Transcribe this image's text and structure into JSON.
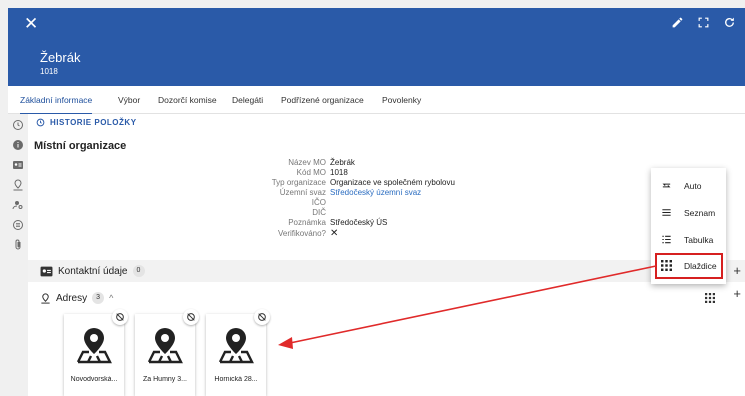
{
  "header": {
    "close_icon": "close-icon",
    "title": "Žebrák",
    "subtitle": "1018",
    "actions": [
      "edit-icon",
      "fullscreen-icon",
      "refresh-icon"
    ]
  },
  "tabs": [
    {
      "label": "Základní informace",
      "active": true
    },
    {
      "label": "Výbor"
    },
    {
      "label": "Dozorčí komise"
    },
    {
      "label": "Delegáti"
    },
    {
      "label": "Podřízené organizace"
    },
    {
      "label": "Povolenky"
    }
  ],
  "history": {
    "label": "HISTORIE POLOŽKY"
  },
  "section": {
    "title": "Místní organizace"
  },
  "details": [
    {
      "label": "Název MO",
      "value": "Žebrák"
    },
    {
      "label": "Kód MO",
      "value": "1018"
    },
    {
      "label": "Typ organizace",
      "value": "Organizace ve společném rybolovu"
    },
    {
      "label": "Územní svaz",
      "value": "Středočeský územní svaz",
      "link": true
    },
    {
      "label": "IČO",
      "value": ""
    },
    {
      "label": "DIČ",
      "value": ""
    },
    {
      "label": "Poznámka",
      "value": "Středočeský ÚS"
    },
    {
      "label": "Verifikováno?",
      "value": "✕"
    }
  ],
  "contacts": {
    "title": "Kontaktní údaje",
    "count": "0"
  },
  "addresses": {
    "title": "Adresy",
    "count": "3"
  },
  "tiles": [
    {
      "label": "Novodvorská..."
    },
    {
      "label": "Za Humny 3..."
    },
    {
      "label": "Hornická 28..."
    }
  ],
  "view_menu": {
    "items": [
      {
        "label": "Auto",
        "icon": "swap-icon"
      },
      {
        "label": "Seznam",
        "icon": "list-icon"
      },
      {
        "label": "Tabulka",
        "icon": "table-icon"
      },
      {
        "label": "Dlaždice",
        "icon": "grid-icon",
        "highlighted": true
      }
    ]
  },
  "colors": {
    "header": "#2a5aa8",
    "highlight": "#d62020",
    "link": "#2a6cc0"
  }
}
